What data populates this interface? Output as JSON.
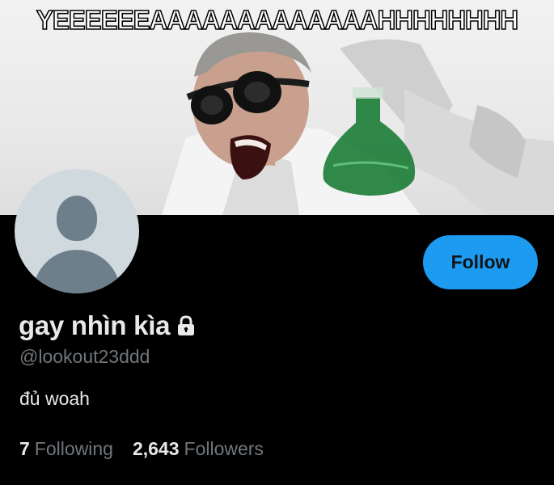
{
  "banner": {
    "caption": "YEEEEEEAAAAAAAAAAAAAHHHHHHHH"
  },
  "profile": {
    "display_name": "gay nhìn kìa",
    "handle": "@lookout23ddd",
    "bio": "đủ woah",
    "protected_icon": "lock-icon",
    "avatar_icon": "default-avatar-icon"
  },
  "actions": {
    "follow_label": "Follow"
  },
  "stats": {
    "following_count": "7",
    "following_label": "Following",
    "followers_count": "2,643",
    "followers_label": "Followers"
  },
  "colors": {
    "accent": "#1d9bf0",
    "background": "#000000",
    "text_primary": "#e7e9ea",
    "text_secondary": "#71767b",
    "avatar_bg": "#cfd9de"
  }
}
